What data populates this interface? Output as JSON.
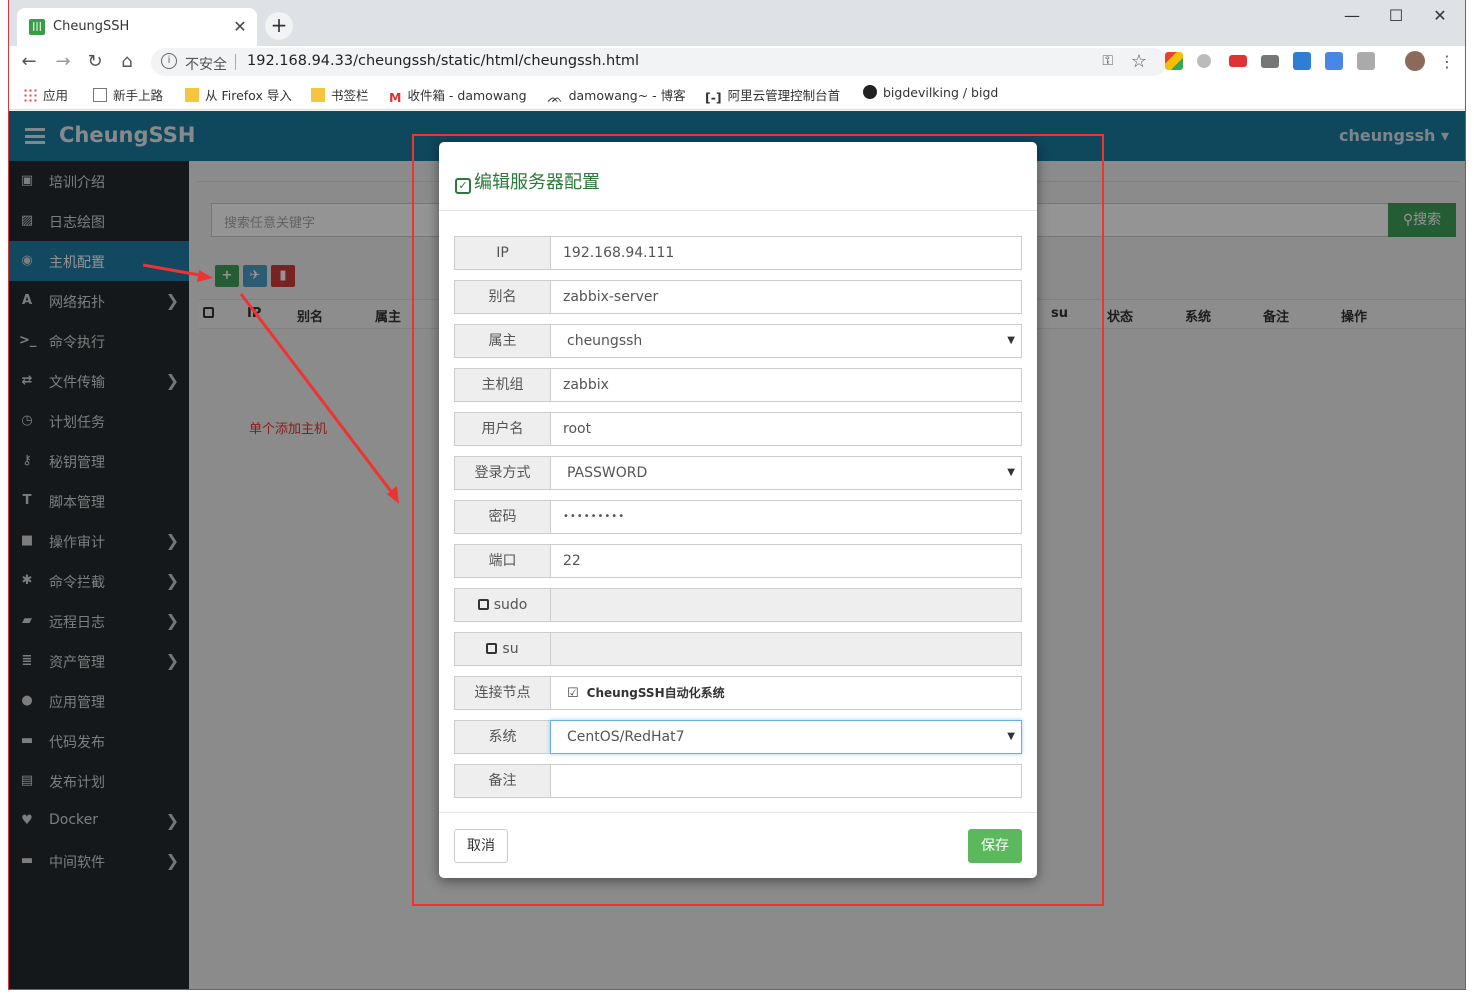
{
  "browser": {
    "tab_title": "CheungSSH",
    "tab_favicon_text": "|||",
    "address_insecure": "不安全",
    "address_url": "192.168.94.33/cheungssh/static/html/cheungssh.html",
    "bookmarks": [
      "应用",
      "新手上路",
      "从 Firefox 导入",
      "书签栏",
      "收件箱 - damowang",
      "damowang~ - 博客",
      "阿里云管理控制台首",
      "bigdevilking / bigd"
    ]
  },
  "app": {
    "brand": "CheungSSH",
    "user_menu": "cheungssh ▾",
    "sidebar": [
      {
        "label": "培训介绍",
        "icon": "film-icon",
        "glyph": "▣",
        "chevron": false,
        "active": false
      },
      {
        "label": "日志绘图",
        "icon": "picture-icon",
        "glyph": "▨",
        "chevron": false,
        "active": false
      },
      {
        "label": "主机配置",
        "icon": "globe-icon",
        "glyph": "◉",
        "chevron": false,
        "active": true
      },
      {
        "label": "网络拓扑",
        "icon": "font-icon",
        "glyph": "A",
        "chevron": true,
        "active": false
      },
      {
        "label": "命令执行",
        "icon": "terminal-icon",
        "glyph": ">_",
        "chevron": false,
        "active": false
      },
      {
        "label": "文件传输",
        "icon": "transfer-icon",
        "glyph": "⇄",
        "chevron": true,
        "active": false
      },
      {
        "label": "计划任务",
        "icon": "clock-icon",
        "glyph": "◷",
        "chevron": false,
        "active": false
      },
      {
        "label": "秘钥管理",
        "icon": "key-icon",
        "glyph": "⚷",
        "chevron": false,
        "active": false
      },
      {
        "label": "脚本管理",
        "icon": "text-icon",
        "glyph": "T",
        "chevron": false,
        "active": false
      },
      {
        "label": "操作审计",
        "icon": "video-icon",
        "glyph": "■",
        "chevron": true,
        "active": false
      },
      {
        "label": "命令拦截",
        "icon": "cog-icon",
        "glyph": "✱",
        "chevron": true,
        "active": false
      },
      {
        "label": "远程日志",
        "icon": "folder-icon",
        "glyph": "▰",
        "chevron": true,
        "active": false
      },
      {
        "label": "资产管理",
        "icon": "tasks-icon",
        "glyph": "≣",
        "chevron": true,
        "active": false
      },
      {
        "label": "应用管理",
        "icon": "apple-icon",
        "glyph": "●",
        "chevron": false,
        "active": false
      },
      {
        "label": "代码发布",
        "icon": "briefcase-icon",
        "glyph": "▬",
        "chevron": false,
        "active": false
      },
      {
        "label": "发布计划",
        "icon": "monitor-icon",
        "glyph": "▤",
        "chevron": false,
        "active": false
      },
      {
        "label": "Docker",
        "icon": "heart-icon",
        "glyph": "♥",
        "chevron": true,
        "active": false
      },
      {
        "label": "中间软件",
        "icon": "briefcase-icon",
        "glyph": "▬",
        "chevron": true,
        "active": false
      }
    ],
    "search_placeholder": "搜索任意关键字",
    "search_button": "搜索",
    "table_headers": {
      "ip": "IP",
      "alias": "别名",
      "owner": "属主",
      "su": "su",
      "status": "状态",
      "system": "系统",
      "remark": "备注",
      "action": "操作"
    },
    "annotation": "单个添加主机"
  },
  "modal": {
    "title": "编辑服务器配置",
    "fields": {
      "ip": {
        "label": "IP",
        "value": "192.168.94.111"
      },
      "alias": {
        "label": "别名",
        "value": "zabbix-server"
      },
      "owner": {
        "label": "属主",
        "value": "cheungssh"
      },
      "group": {
        "label": "主机组",
        "value": "zabbix"
      },
      "username": {
        "label": "用户名",
        "value": "root"
      },
      "login": {
        "label": "登录方式",
        "value": "PASSWORD"
      },
      "password": {
        "label": "密码",
        "value": "•••••••••"
      },
      "port": {
        "label": "端口",
        "value": "22"
      },
      "sudo": {
        "label": "sudo",
        "value": ""
      },
      "su": {
        "label": "su",
        "value": ""
      },
      "node": {
        "label": "连接节点",
        "value": "CheungSSH自动化系统"
      },
      "system": {
        "label": "系统",
        "value": "CentOS/RedHat7"
      },
      "remark": {
        "label": "备注",
        "value": ""
      }
    },
    "cancel_label": "取消",
    "save_label": "保存"
  }
}
